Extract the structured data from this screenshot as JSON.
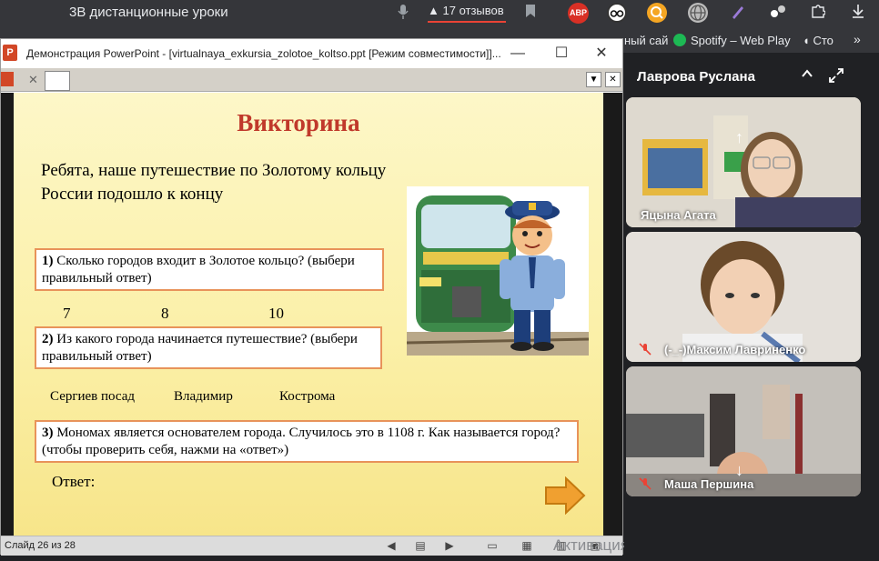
{
  "browser": {
    "tab_title": "3В дистанционные уроки",
    "reviews_label": "17 отзывов",
    "abp_label": "ABP"
  },
  "bookmarks": {
    "left_fragment": "ный сай",
    "spotify": "Spotify – Web Play",
    "right_fragment": "Сто"
  },
  "ppt": {
    "window_title": "Демонстрация PowerPoint - [virtualnaya_exkursia_zolotoe_koltso.ppt [Режим совместимости]]...",
    "status_slide": "Слайд 26 из 28"
  },
  "slide": {
    "title": "Викторина",
    "intro": "Ребята, наше путешествие по Золотому кольцу России подошло к концу",
    "q1_num": "1)",
    "q1_text": "Сколько городов входит в Золотое кольцо? (выбери правильный ответ)",
    "q1_options": [
      "7",
      "8",
      "10"
    ],
    "q2_num": "2)",
    "q2_text": "Из какого города начинается путешествие? (выбери правильный ответ)",
    "q2_options": [
      "Сергиев посад",
      "Владимир",
      "Кострома"
    ],
    "q3_num": "3)",
    "q3_text": "Мономах является основателем города. Случилось это в 1108 г. Как называется город? (чтобы проверить себя, нажми на «ответ»)",
    "answer_label": "Ответ:"
  },
  "video": {
    "panel_name": "Лаврова Руслана",
    "participants": [
      {
        "name": "Яцына Агата"
      },
      {
        "name": "(-_-)Максим Лавриненко"
      },
      {
        "name": "Маша Першина"
      }
    ]
  },
  "activation_text": "Активация Windows",
  "colors": {
    "slide_title": "#c0392b",
    "box_border": "#e8935a",
    "arrow": "#f0a030"
  }
}
